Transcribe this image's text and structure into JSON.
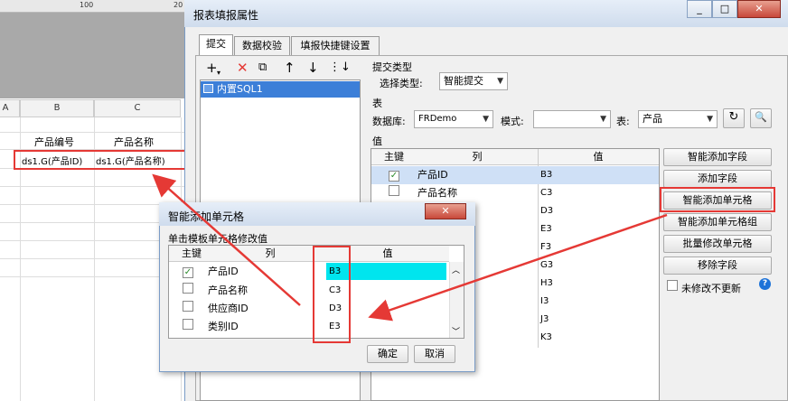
{
  "sheet": {
    "ruler_mark": "100",
    "col_a": "A",
    "col_b": "B",
    "col_c": "C",
    "hdr_b": "产品编号",
    "hdr_c": "产品名称",
    "cell_b": "ds1.G(产品ID)",
    "cell_c": "ds1.G(产品名称)"
  },
  "dialog": {
    "title": "报表填报属性",
    "tabs": [
      "提交",
      "数据校验",
      "填报快捷键设置"
    ],
    "toolbar": [
      "plus-icon",
      "delete-icon",
      "copy-icon",
      "up-arrow-icon",
      "down-arrow-icon",
      "sort-icon"
    ],
    "list_item": "内置SQL1",
    "submit_type_group": "提交类型",
    "select_type_label": "选择类型:",
    "select_type_value": "智能提交",
    "table_group": "表",
    "db_label": "数据库:",
    "db_value": "FRDemo",
    "schema_label": "模式:",
    "schema_value": "",
    "table_label": "表:",
    "table_value": "产品",
    "value_group": "值",
    "grid_headers": [
      "主键",
      "列",
      "值"
    ],
    "rows": [
      {
        "key": true,
        "col": "产品ID",
        "val": "B3"
      },
      {
        "key": false,
        "col": "产品名称",
        "val": "C3"
      },
      {
        "key": false,
        "col": "",
        "val": "D3"
      },
      {
        "key": false,
        "col": "",
        "val": "E3"
      },
      {
        "key": false,
        "col": "",
        "val": "F3"
      },
      {
        "key": false,
        "col": "",
        "val": "G3"
      },
      {
        "key": false,
        "col": "",
        "val": "H3"
      },
      {
        "key": false,
        "col": "",
        "val": "I3"
      },
      {
        "key": false,
        "col": "",
        "val": "J3"
      },
      {
        "key": false,
        "col": "",
        "val": "K3"
      }
    ],
    "buttons": [
      "智能添加字段",
      "添加字段",
      "智能添加单元格",
      "智能添加单元格组",
      "批量修改单元格",
      "移除字段"
    ],
    "no_update_label": "未修改不更新",
    "help_icon": "?"
  },
  "smart_dialog": {
    "title": "智能添加单元格",
    "hint": "单击模板单元格修改值",
    "headers": [
      "主键",
      "列",
      "值"
    ],
    "rows": [
      {
        "key": true,
        "col": "产品ID",
        "val": "B3"
      },
      {
        "key": false,
        "col": "产品名称",
        "val": "C3"
      },
      {
        "key": false,
        "col": "供应商ID",
        "val": "D3"
      },
      {
        "key": false,
        "col": "类别ID",
        "val": "E3"
      }
    ],
    "ok": "确定",
    "cancel": "取消"
  },
  "colors": {
    "highlight_red": "#e53935",
    "selection_blue": "#3c7fd8",
    "editing_cyan": "#00e5ee"
  }
}
